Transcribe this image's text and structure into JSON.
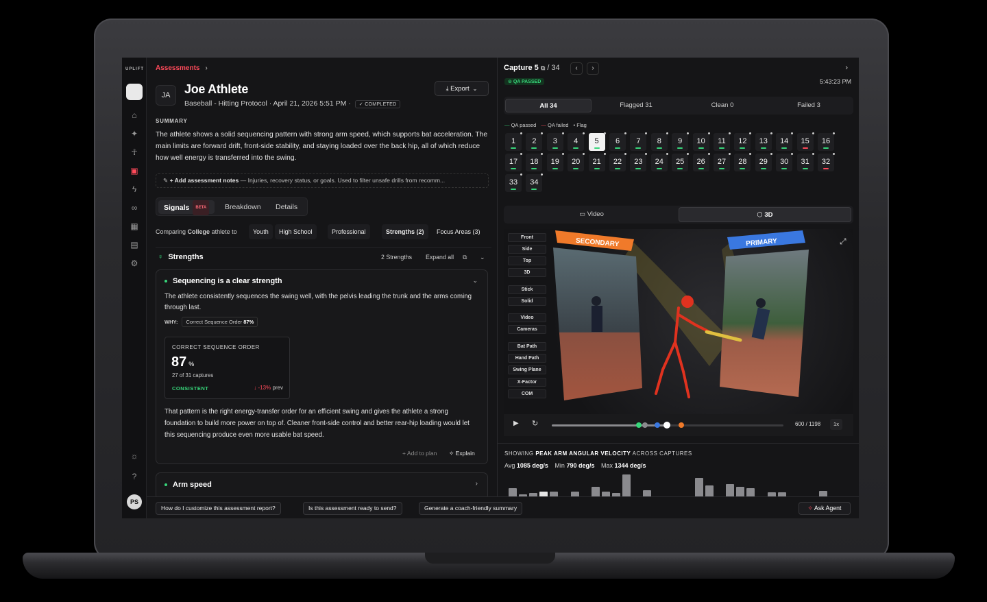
{
  "brand": "UPLIFT",
  "breadcrumb": {
    "label": "Assessments"
  },
  "athlete": {
    "initials": "JA",
    "name": "Joe Athlete",
    "meta": "Baseball - Hitting Protocol  ·  April 21, 2026 5:51 PM  ·",
    "status": "✓ COMPLETED"
  },
  "export_label": "Export",
  "summary": {
    "heading": "SUMMARY",
    "text": "The athlete shows a solid sequencing pattern with strong arm speed, which supports bat acceleration. The main limits are forward drift, front-side stability, and staying loaded over the back hip, all of which reduce how well energy is transferred into the swing."
  },
  "notes": {
    "label": "+ Add assessment notes",
    "hint": " — Injuries, recovery status, or goals. Used to filter unsafe drills from recomm..."
  },
  "tabs": {
    "signals": "Signals",
    "beta": "BETA",
    "breakdown": "Breakdown",
    "details": "Details"
  },
  "compare": {
    "prefix": "Comparing",
    "level": "College",
    "suffix": "athlete to",
    "chips": [
      "Youth",
      "High School",
      "Professional"
    ],
    "strengths": "Strengths  (2)",
    "focus": "Focus Areas  (3)"
  },
  "strengths": {
    "title": "Strengths",
    "count": "2 Strengths",
    "expand": "Expand all"
  },
  "card1": {
    "title": "Sequencing is a clear strength",
    "text": "The athlete consistently sequences the swing well, with the pelvis leading the trunk and the arms coming through last.",
    "why": "WHY:",
    "why_chip": "Correct Sequence Order",
    "why_val": "87%",
    "stat_title": "CORRECT SEQUENCE ORDER",
    "stat_val": "87",
    "stat_unit": "%",
    "stat_sub": "27 of 31 captures",
    "stat_tag": "CONSISTENT",
    "stat_delta": "↓ -13%",
    "stat_delta_suffix": "prev",
    "body": "That pattern is the right energy-transfer order for an efficient swing and gives the athlete a strong foundation to build more power on top of. Cleaner front-side control and better rear-hip loading would let this sequencing produce even more usable bat speed.",
    "add": "+ Add to plan",
    "explain": "Explain"
  },
  "card2": {
    "title": "Arm speed"
  },
  "capture": {
    "label": "Capture 5",
    "total": "/ 34",
    "qa": "QA PASSED",
    "time": "5:43:23 PM"
  },
  "filters": [
    {
      "label": "All",
      "n": "34"
    },
    {
      "label": "Flagged",
      "n": "31"
    },
    {
      "label": "Clean",
      "n": "0"
    },
    {
      "label": "Failed",
      "n": "3"
    }
  ],
  "legend": {
    "passed": "QA passed",
    "failed": "QA failed",
    "flag": "Flag"
  },
  "captures": [
    "1",
    "2",
    "3",
    "4",
    "5",
    "6",
    "7",
    "8",
    "9",
    "10",
    "11",
    "12",
    "13",
    "14",
    "15",
    "16",
    "17",
    "18",
    "19",
    "20",
    "21",
    "22",
    "23",
    "24",
    "25",
    "26",
    "27",
    "28",
    "29",
    "30",
    "31",
    "32",
    "33",
    "34"
  ],
  "failed_captures": [
    "15",
    "32"
  ],
  "selected_capture": "5",
  "view_tabs": {
    "video": "Video",
    "three_d": "3D"
  },
  "view_options": [
    "Front",
    "Side",
    "Top",
    "3D",
    "Stick",
    "Solid",
    "Video",
    "Cameras",
    "Bat Path",
    "Hand Path",
    "Swing Plane",
    "X-Factor",
    "COM"
  ],
  "cameras": {
    "secondary": "SECONDARY",
    "primary": "PRIMARY"
  },
  "player": {
    "frame": "600 / 1198",
    "speed": "1x",
    "progress": 0.5
  },
  "metric": {
    "showing": "SHOWING",
    "name": "PEAK ARM ANGULAR VELOCITY",
    "across": "ACROSS CAPTURES",
    "avg_l": "Avg",
    "avg": "1085 deg/s",
    "min_l": "Min",
    "min": "790 deg/s",
    "max_l": "Max",
    "max": "1344 deg/s"
  },
  "chart_data": {
    "type": "bar",
    "values": [
      12,
      4,
      6,
      8,
      8,
      0,
      8,
      0,
      14,
      8,
      6,
      30,
      0,
      10,
      0,
      0,
      0,
      0,
      26,
      16,
      0,
      18,
      14,
      12,
      0,
      7,
      7,
      0,
      0,
      0,
      9
    ],
    "ylabel": "",
    "xlabel": ""
  },
  "footer": {
    "suggestions": [
      "How do I customize this assessment report?",
      "Is this assessment ready to send?",
      "Generate a coach-friendly summary"
    ],
    "agent": "Ask Agent"
  },
  "user_initials": "PS",
  "colors": {
    "accent": "#ff4a5a",
    "pass": "#37d67a",
    "fail": "#ff4a5a"
  }
}
